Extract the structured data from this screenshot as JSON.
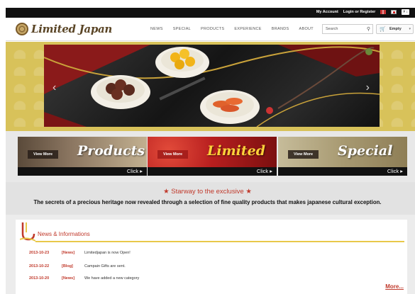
{
  "topbar": {
    "my_account": "My Account",
    "login": "Login or Register",
    "currency": "¥ ↕"
  },
  "header": {
    "logo_text": "Limited Japan",
    "nav": [
      "NEWS",
      "SPECIAL",
      "PRODUCTS",
      "EXPERIENCE",
      "BRANDS",
      "ABOUT"
    ],
    "search_placeholder": "Search",
    "cart_label": "Empty"
  },
  "hero": {
    "prev": "‹",
    "next": "›"
  },
  "tiles": [
    {
      "view_more": "View More",
      "word": "Products",
      "click": "Click ▸"
    },
    {
      "view_more": "View More",
      "word": "Limited",
      "click": "Click ▸"
    },
    {
      "view_more": "View More",
      "word": "Special",
      "click": "Click ▸"
    }
  ],
  "tagline": {
    "headline": "★ Starway to the exclusive ★",
    "subline": "The secrets of a precious heritage now revealed through a selection of fine quality products that makes japanese cultural exception."
  },
  "news": {
    "title": "News & Informations",
    "items": [
      {
        "date": "2013-10-23",
        "category": "[News]",
        "text": "Limitedjapan is now Open!"
      },
      {
        "date": "2013-10-22",
        "category": "[Blog]",
        "text": "Campain Gifts are sent."
      },
      {
        "date": "2013-10-20",
        "category": "[News]",
        "text": "We have added a new category"
      }
    ],
    "more": "More..."
  },
  "colors": {
    "accent": "#c0392b",
    "gold": "#d8c25a",
    "topbar": "#111111"
  }
}
